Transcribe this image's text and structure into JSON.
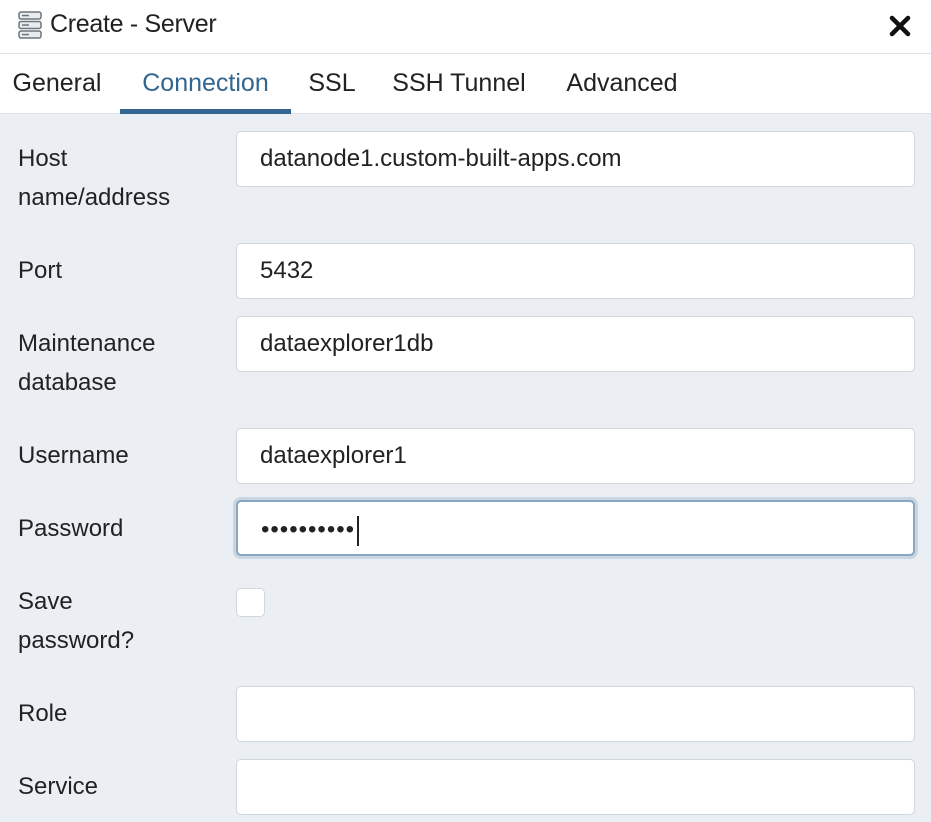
{
  "dialog": {
    "title": "Create - Server",
    "title_icon": "server-icon",
    "close_icon": "close-icon"
  },
  "tabs": [
    {
      "label": "General",
      "active": false
    },
    {
      "label": "Connection",
      "active": true
    },
    {
      "label": "SSL",
      "active": false
    },
    {
      "label": "SSH Tunnel",
      "active": false
    },
    {
      "label": "Advanced",
      "active": false
    }
  ],
  "fields": {
    "host": {
      "label_line1": "Host",
      "label_line2": "name/address",
      "value": "datanode1.custom-built-apps.com"
    },
    "port": {
      "label": "Port",
      "value": "5432"
    },
    "maintenance_db": {
      "label_line1": "Maintenance",
      "label_line2": "database",
      "value": "dataexplorer1db"
    },
    "username": {
      "label": "Username",
      "value": "dataexplorer1"
    },
    "password": {
      "label": "Password",
      "masked_value": "••••••••••"
    },
    "save_password": {
      "label_line1": "Save",
      "label_line2": "password?",
      "checked": false
    },
    "role": {
      "label": "Role",
      "value": ""
    },
    "service": {
      "label": "Service",
      "value": ""
    }
  },
  "colors": {
    "accent": "#326690",
    "background": "#ebeff4",
    "focus_ring": "#8aa6c1"
  }
}
